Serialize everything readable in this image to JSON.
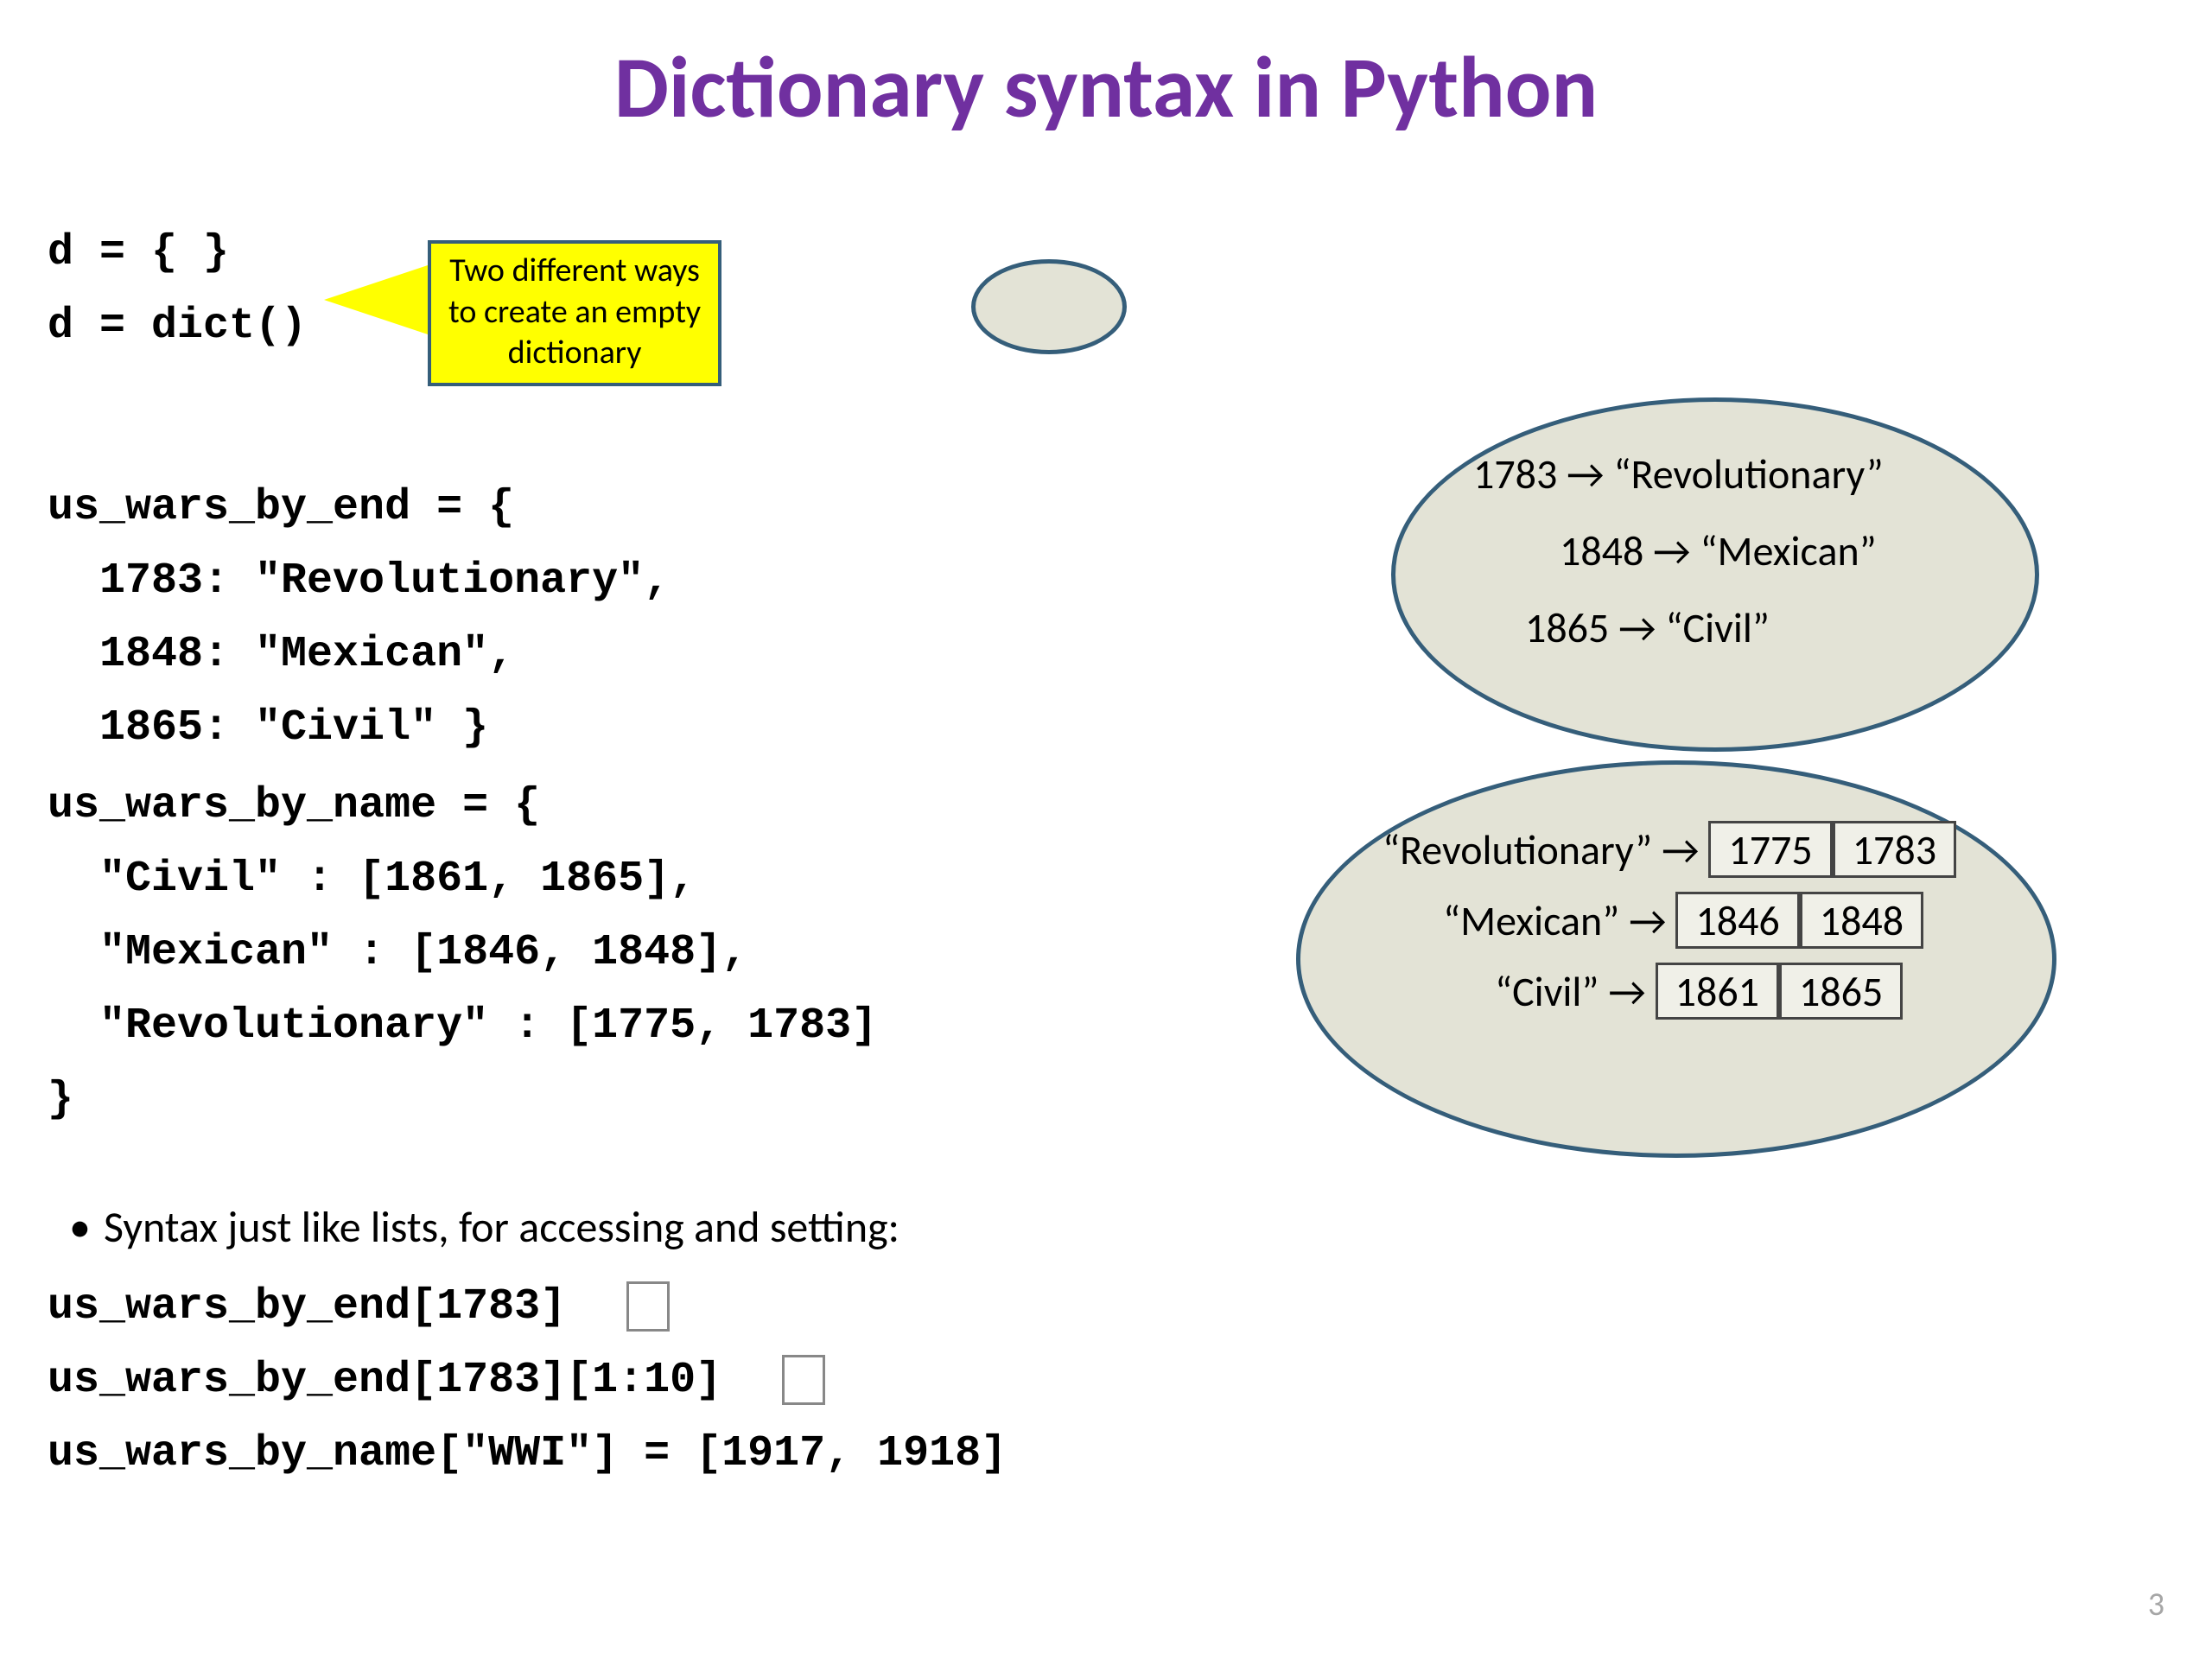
{
  "title": "Dictionary syntax in Python",
  "callout": {
    "l1": "Two different ways",
    "l2": "to create an empty",
    "l3": "dictionary"
  },
  "code": {
    "empty_d1": "d = { }",
    "empty_d2": "d = dict()",
    "by_end_1": "us_wars_by_end = {",
    "by_end_2": "  1783: \"Revolutionary\",",
    "by_end_3": "  1848: \"Mexican\",",
    "by_end_4": "  1865: \"Civil\" }",
    "by_name_1": "us_wars_by_name = {",
    "by_name_2": "  \"Civil\" : [1861, 1865],",
    "by_name_3": "  \"Mexican\" : [1846, 1848],",
    "by_name_4": "  \"Revolutionary\" : [1775, 1783]",
    "by_name_5": "}",
    "access_1": "us_wars_by_end[1783]",
    "access_2": "us_wars_by_end[1783][1:10]",
    "access_3": "us_wars_by_name[\"WWI\"] = [1917, 1918]"
  },
  "thought1": {
    "row1": "1783 → “Revolutionary”",
    "row2": "1848 → “Mexican”",
    "row3": "1865 → “Civil”"
  },
  "thought2": {
    "rows": [
      {
        "label": "“Revolutionary” → ",
        "cells": [
          "1775",
          "1783"
        ]
      },
      {
        "label": "“Mexican” → ",
        "cells": [
          "1846",
          "1848"
        ]
      },
      {
        "label": "“Civil” → ",
        "cells": [
          "1861",
          "1865"
        ]
      }
    ]
  },
  "bullet": "Syntax just like lists, for accessing and setting:",
  "pagenum": "3"
}
